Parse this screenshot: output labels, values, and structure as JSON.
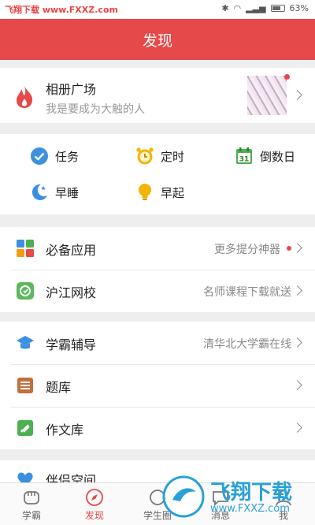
{
  "status_bar": {
    "left_text": "飞翔下载 www.FXXZ.com",
    "battery": "63%"
  },
  "app_bar": {
    "title": "发现"
  },
  "album": {
    "title": "相册广场",
    "subtitle": "我是要成为大触的人"
  },
  "tools": [
    {
      "label": "任务",
      "icon": "task-check-icon"
    },
    {
      "label": "定时",
      "icon": "alarm-clock-icon"
    },
    {
      "label": "倒数日",
      "icon": "calendar-31-icon",
      "icon_text": "31"
    },
    {
      "label": "早睡",
      "icon": "moon-icon"
    },
    {
      "label": "早起",
      "icon": "lightbulb-icon"
    }
  ],
  "section1": [
    {
      "label": "必备应用",
      "right_text": "更多提分神器",
      "icon": "app-grid-icon"
    },
    {
      "label": "沪江网校",
      "right_text": "名师课程下载就送",
      "icon": "hujiang-icon"
    }
  ],
  "section2": [
    {
      "label": "学霸辅导",
      "right_text": "清华北大学霸在线",
      "icon": "graduation-cap-icon"
    },
    {
      "label": "题库",
      "right_text": "",
      "icon": "question-bank-icon"
    },
    {
      "label": "作文库",
      "right_text": "",
      "icon": "pen-icon"
    }
  ],
  "section3": {
    "label": "伴侣空间"
  },
  "bottom_nav": [
    {
      "label": "学霸",
      "icon": "fist-icon"
    },
    {
      "label": "发现",
      "icon": "compass-icon",
      "active": true
    },
    {
      "label": "学生圈",
      "icon": "circle-icon"
    },
    {
      "label": "消息",
      "icon": "message-icon"
    },
    {
      "label": "我",
      "icon": "user-icon"
    }
  ],
  "watermark": {
    "text": "飞翔下载",
    "url": "www.FXXZ.com"
  },
  "colors": {
    "accent": "#e5494a",
    "watermark": "#2aa0d8"
  }
}
